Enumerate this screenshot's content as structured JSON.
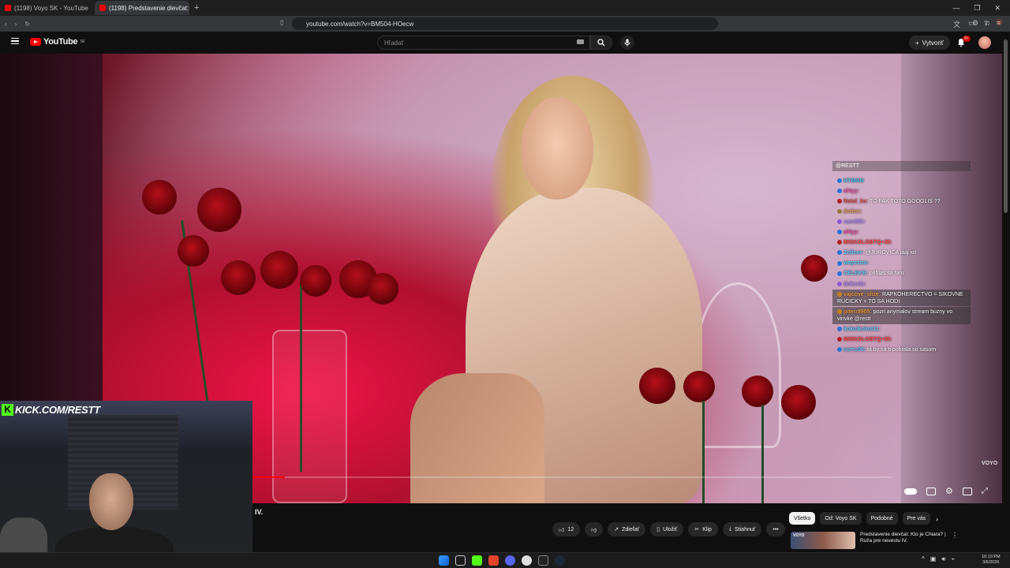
{
  "browser": {
    "tabs": [
      {
        "label": "(1198) Voyo SK - YouTube"
      },
      {
        "label": "(1198) Predstavenie dievčat: K"
      }
    ],
    "url": "youtube.com/watch?v=BM504-HOecw"
  },
  "youtube": {
    "logo_text": "YouTube",
    "region": "SK",
    "search_placeholder": "Hľadať",
    "create_label": "Vytvoriť",
    "notification_count": "9+"
  },
  "video": {
    "watermark": "VOYO",
    "progress_fraction": 0.05
  },
  "chat": {
    "header": "@RESTT",
    "messages": [
      {
        "user": "HYMAN",
        "text": "",
        "color": "#3ec1f0",
        "badge": "#2a72d6"
      },
      {
        "user": "al4yy:",
        "text": "",
        "color": "#f04fa0",
        "badge": "#2a72d6"
      },
      {
        "user": "Natal_ka:",
        "text": "TO FAK TOTO GOOGLIS ??",
        "color": "#e05252",
        "badge": "#b02020"
      },
      {
        "user": "dettox:",
        "text": "",
        "color": "#e0a15a",
        "badge": "#9a7a3a"
      },
      {
        "user": "sam88k:",
        "text": "",
        "color": "#b58bff",
        "badge": "#8a5ad6"
      },
      {
        "user": "al4yy:",
        "text": "",
        "color": "#f04fa0",
        "badge": "#2a72d6"
      },
      {
        "user": "MISKOLGBTQ+35:",
        "text": "",
        "color": "#ff4545",
        "badge": "#b02020"
      },
      {
        "user": "Zollner:",
        "text": "@JUROVICA jááj xd",
        "color": "#5ec7ff",
        "badge": "#2a72d6"
      },
      {
        "user": "wayzzizo:",
        "text": "",
        "color": "#4fd0ff",
        "badge": "#2a72d6"
      },
      {
        "user": "CELEKE:",
        "text": "prihlas sa tam",
        "color": "#5ec7ff",
        "badge": "#2a72d6"
      },
      {
        "user": "dokevla:",
        "text": "",
        "color": "#b58bff",
        "badge": "#8a5ad6"
      },
      {
        "user": "vajcove_slize:",
        "text": "RAPKOHERECTVO = SIKOVNE RUCICKY = TO SA HODI",
        "color": "#f0a040",
        "badge": "#c08020"
      },
      {
        "user": "piterr8905:",
        "text": "pozri anymalov stream buzny vo virivke @restt",
        "color": "#f0a040",
        "badge": "#c08020"
      },
      {
        "user": "kokotkokot11:",
        "text": "",
        "color": "#5ec7ff",
        "badge": "#2a72d6"
      },
      {
        "user": "MISKOLGBTQ+35:",
        "text": "",
        "color": "#ff4545",
        "badge": "#b02020"
      },
      {
        "user": "curru06:",
        "text": "tá by sa ti pohrala so sasom",
        "color": "#5ec7ff",
        "badge": "#2a72d6"
      }
    ]
  },
  "webcam": {
    "overlay_text": "KICK.COM/RESTT",
    "overlay_k": "K"
  },
  "below": {
    "title_fragment": "IV.",
    "like_count": "12",
    "share_label": "Zdieľať",
    "save_label": "Uložiť",
    "clip_label": "Klip",
    "download_label": "Stiahnuť",
    "more_label": "•••",
    "chips": [
      "Všetko",
      "Od: Voyo SK",
      "Podobné",
      "Pre vás"
    ],
    "rec_thumb_label": "VOYO",
    "rec_title": "Predstavenie dievčat: Kto je Chiara? | Ruža pre nevestu IV."
  },
  "taskbar": {
    "time": "10:10 PM",
    "date": "3/6/2026"
  },
  "colors": {
    "accent_red": "#ff0000",
    "kick_green": "#53fc18",
    "background": "#0f0f0f"
  }
}
